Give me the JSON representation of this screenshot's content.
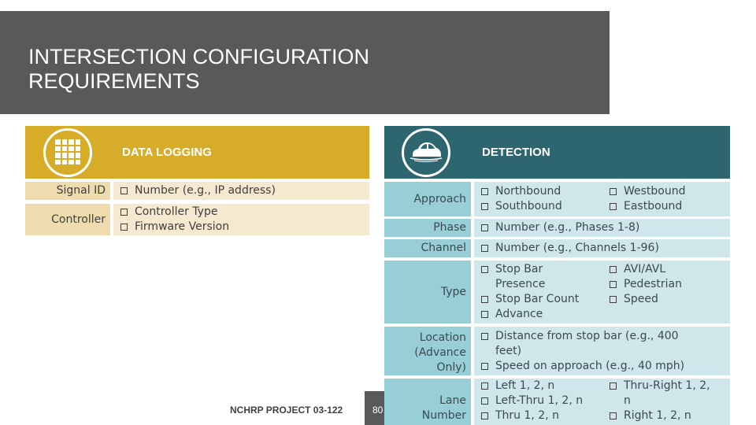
{
  "title": {
    "line1": "INTERSECTION CONFIGURATION",
    "line2": "REQUIREMENTS"
  },
  "colors": {
    "title_bar": "#58595b",
    "data_logging_accent": "#d7ac29",
    "detection_accent": "#2e6670"
  },
  "data_logging": {
    "icon": "grid-icon",
    "title": "DATA LOGGING",
    "rows": [
      {
        "label": "Signal ID",
        "items": [
          "Number (e.g., IP address)"
        ]
      },
      {
        "label": "Controller",
        "items": [
          "Controller Type",
          "Firmware Version"
        ]
      }
    ]
  },
  "detection": {
    "icon": "car-icon",
    "title": "DETECTION",
    "rows": [
      {
        "label": "Approach",
        "col1": [
          "Northbound",
          "Southbound"
        ],
        "col2": [
          "Westbound",
          "Eastbound"
        ]
      },
      {
        "label": "Phase",
        "items": [
          "Number (e.g., Phases 1-8)"
        ]
      },
      {
        "label": "Channel",
        "items": [
          "Number (e.g., Channels 1-96)"
        ]
      },
      {
        "label": "Type",
        "col1": [
          "Stop Bar",
          "Presence",
          "Stop Bar Count",
          "Advance"
        ],
        "col2": [
          "AVI/AVL",
          "Pedestrian",
          "Speed"
        ]
      },
      {
        "label_lines": [
          "Location",
          "(Advance",
          "Only)"
        ],
        "items": [
          "Distance from stop bar (e.g., 400",
          "feet)",
          "Speed on approach (e.g., 40 mph)"
        ]
      },
      {
        "label_lines": [
          "Lane",
          "Number"
        ],
        "col1": [
          "Left 1, 2, n",
          "Left-Thru 1, 2, n",
          "Thru 1, 2, n"
        ],
        "col2": [
          "Thru-Right 1, 2,",
          "n",
          "Right 1, 2, n"
        ]
      }
    ]
  },
  "footer": {
    "project": "NCHRP PROJECT 03-122",
    "page_number": "80"
  }
}
